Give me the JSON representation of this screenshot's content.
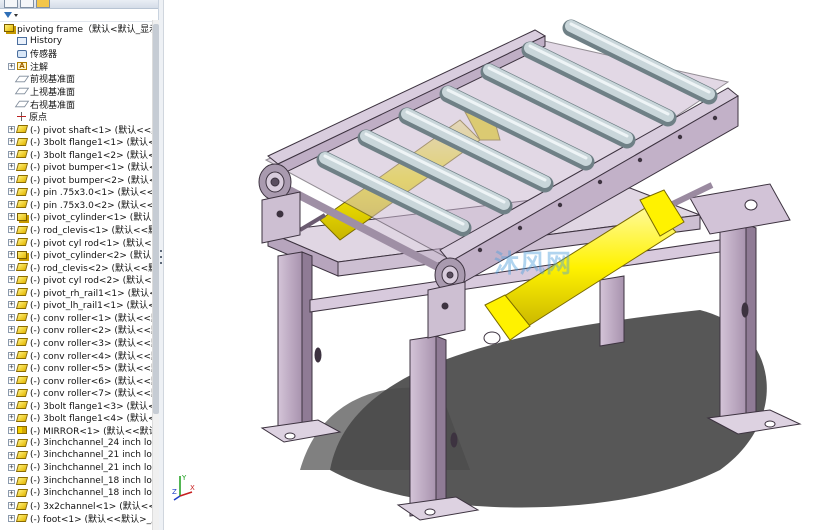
{
  "tree": {
    "root_label": "pivoting frame（默认<默认_显示状",
    "items": [
      {
        "label": "History",
        "icon": "history-icon",
        "exp": false
      },
      {
        "label": "传感器",
        "icon": "sensor-icon",
        "exp": false
      },
      {
        "label": "注解",
        "icon": "annotation-icon",
        "exp": true
      },
      {
        "label": "前视基准面",
        "icon": "plane-icon",
        "exp": false
      },
      {
        "label": "上视基准面",
        "icon": "plane-icon",
        "exp": false
      },
      {
        "label": "右视基准面",
        "icon": "plane-icon",
        "exp": false
      },
      {
        "label": "原点",
        "icon": "origin-icon",
        "exp": false
      },
      {
        "label": "(-) pivot shaft<1> (默认<<默认",
        "icon": "part-icon",
        "exp": true
      },
      {
        "label": "(-) 3bolt flange1<1> (默认<<",
        "icon": "part-icon",
        "exp": true
      },
      {
        "label": "(-) 3bolt flange1<2> (默认<<",
        "icon": "part-icon",
        "exp": true
      },
      {
        "label": "(-) pivot bumper<1> (默认<<",
        "icon": "part-icon",
        "exp": true
      },
      {
        "label": "(-) pivot bumper<2> (默认<<",
        "icon": "part-icon",
        "exp": true
      },
      {
        "label": "(-) pin .75x3.0<1> (默认<<默",
        "icon": "part-icon",
        "exp": true
      },
      {
        "label": "(-) pin .75x3.0<2> (默认<<默",
        "icon": "part-icon",
        "exp": true
      },
      {
        "label": "(-) pivot_cylinder<1> (默认<",
        "icon": "assembly-icon",
        "exp": true
      },
      {
        "label": "(-) rod_clevis<1> (默认<<默认",
        "icon": "part-icon",
        "exp": true
      },
      {
        "label": "(-) pivot cyl rod<1> (默认<<默",
        "icon": "part-icon",
        "exp": true
      },
      {
        "label": "(-) pivot_cylinder<2> (默认<",
        "icon": "assembly-icon",
        "exp": true
      },
      {
        "label": "(-) rod_clevis<2> (默认<<默认",
        "icon": "part-icon",
        "exp": true
      },
      {
        "label": "(-) pivot cyl rod<2> (默认<<默",
        "icon": "part-icon",
        "exp": true
      },
      {
        "label": "(-) pivot_rh_rail1<1> (默认<<",
        "icon": "part-icon",
        "exp": true
      },
      {
        "label": "(-) pivot_lh_rail1<1> (默认<<",
        "icon": "part-icon",
        "exp": true
      },
      {
        "label": "(-) conv roller<1> (默认<<默",
        "icon": "part-icon",
        "exp": true
      },
      {
        "label": "(-) conv roller<2> (默认<<默",
        "icon": "part-icon",
        "exp": true
      },
      {
        "label": "(-) conv roller<3> (默认<<默",
        "icon": "part-icon",
        "exp": true
      },
      {
        "label": "(-) conv roller<4> (默认<<默",
        "icon": "part-icon",
        "exp": true
      },
      {
        "label": "(-) conv roller<5> (默认<<默",
        "icon": "part-icon",
        "exp": true
      },
      {
        "label": "(-) conv roller<6> (默认<<默",
        "icon": "part-icon",
        "exp": true
      },
      {
        "label": "(-) conv roller<7> (默认<<默",
        "icon": "part-icon",
        "exp": true
      },
      {
        "label": "(-) 3bolt flange1<3> (默认<<",
        "icon": "part-icon",
        "exp": true
      },
      {
        "label": "(-) 3bolt flange1<4> (默认<<",
        "icon": "part-icon",
        "exp": true
      },
      {
        "label": "(-) MIRROR<1> (默认<<默认",
        "icon": "mirror-icon",
        "exp": true
      },
      {
        "label": "(-) 3inchchannel_24 inch long",
        "icon": "part-icon",
        "exp": true
      },
      {
        "label": "(-) 3inchchannel_21 inch long",
        "icon": "part-icon",
        "exp": true
      },
      {
        "label": "(-) 3inchchannel_21 inch long",
        "icon": "part-icon",
        "exp": true
      },
      {
        "label": "(-) 3inchchannel_18 inch long",
        "icon": "part-icon",
        "exp": true
      },
      {
        "label": "(-) 3inchchannel_18 inch long",
        "icon": "part-icon",
        "exp": true
      },
      {
        "label": "(-) 3x2channel<1> (默认<<默认",
        "icon": "part-icon",
        "exp": true
      },
      {
        "label": "(-) foot<1> (默认<<默认>_显",
        "icon": "part-icon",
        "exp": true
      }
    ]
  },
  "viewport": {
    "watermark": "沐风网",
    "triad": {
      "x": "X",
      "y": "Y",
      "z": "Z"
    }
  },
  "colors": {
    "frame": "#c8b4cd",
    "frame_dark": "#8f7b95",
    "roller": "#b8c8cc",
    "cylinder": "#fff200",
    "cylinder_dark": "#c7b400",
    "shadow": "#3a3a3a"
  }
}
